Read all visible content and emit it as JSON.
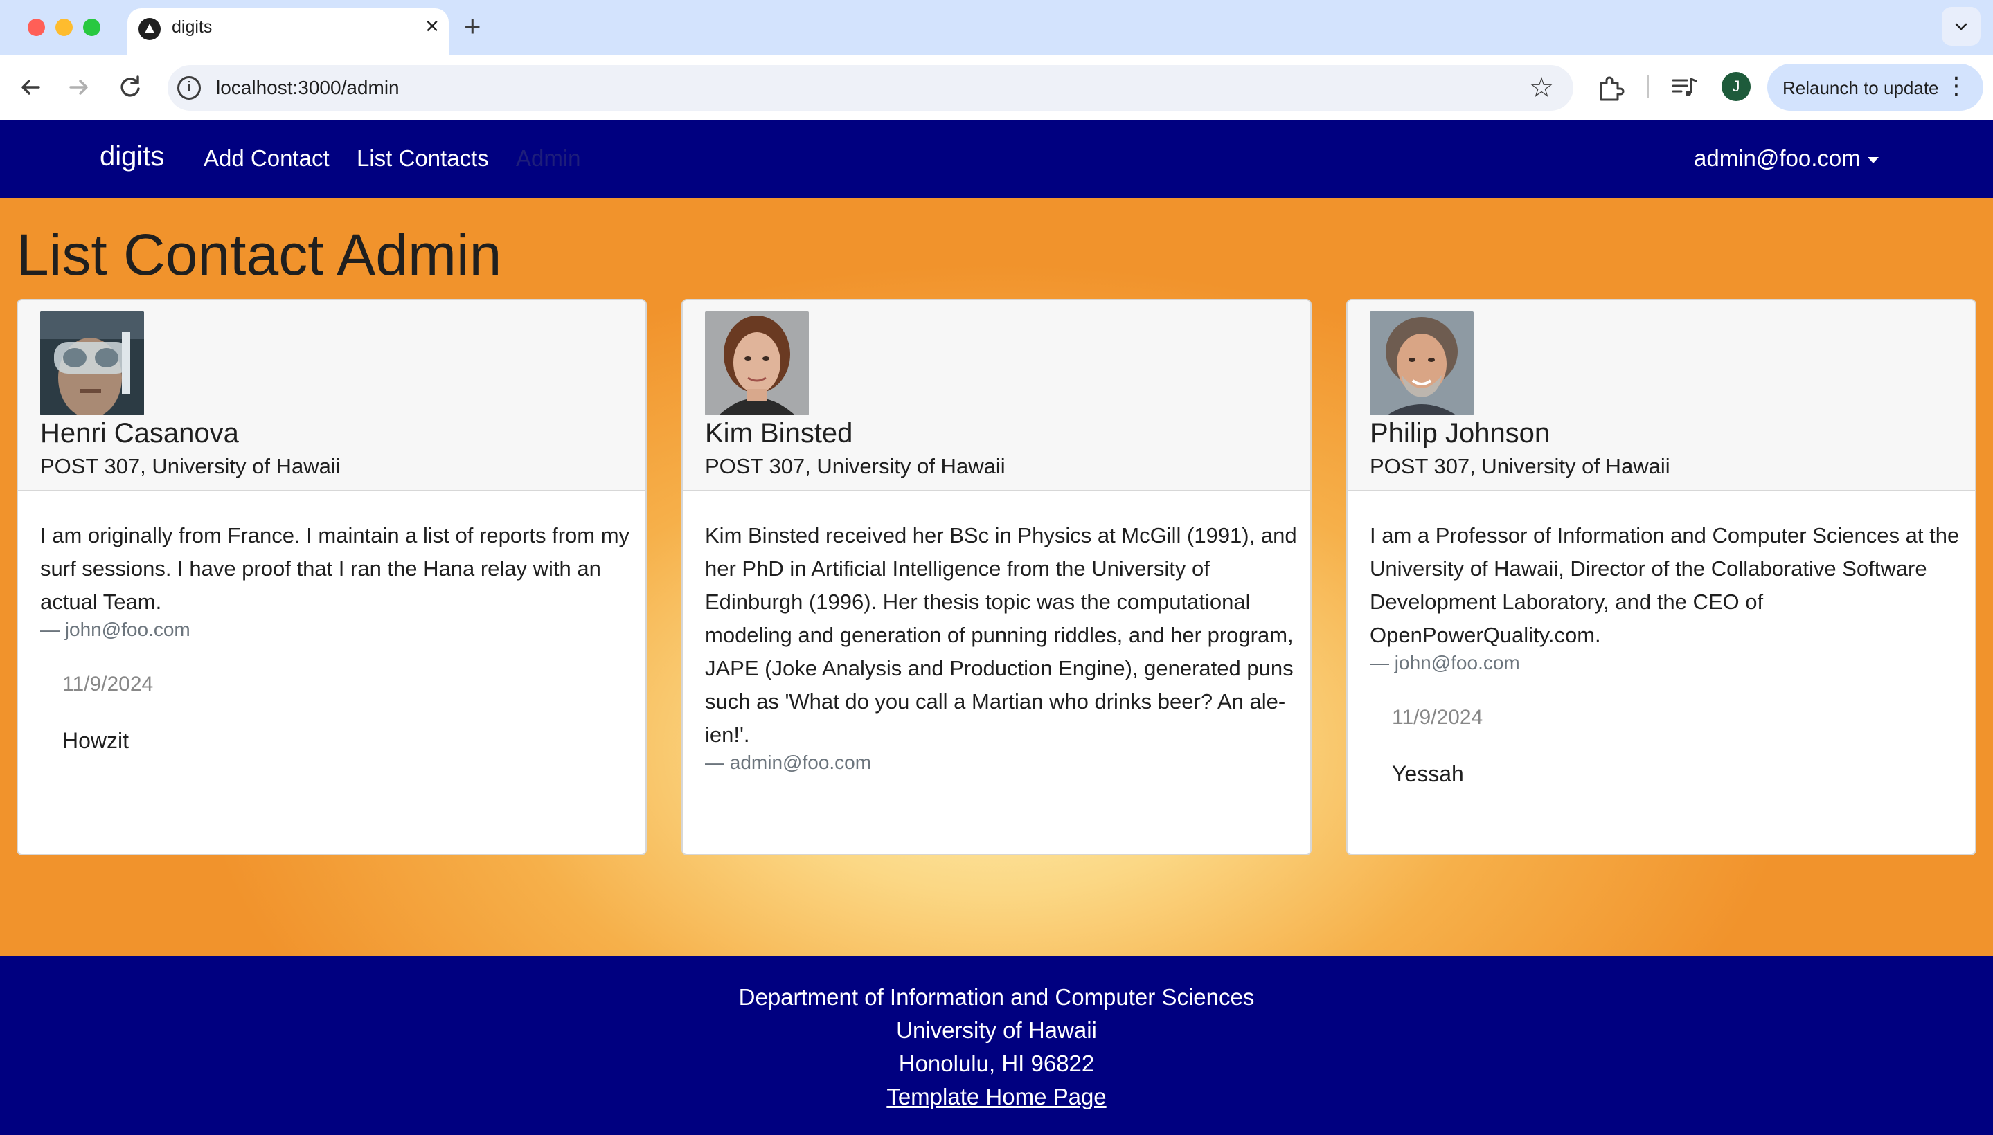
{
  "browser": {
    "tab_title": "digits",
    "url": "localhost:3000/admin",
    "profile_initial": "J",
    "relaunch_label": "Relaunch to update"
  },
  "navbar": {
    "brand": "digits",
    "links": [
      "Add Contact",
      "List Contacts",
      "Admin"
    ],
    "active_link": "Admin",
    "user": "admin@foo.com"
  },
  "page": {
    "title": "List Contact Admin"
  },
  "contacts": [
    {
      "name": "Henri Casanova",
      "address": "POST 307, University of Hawaii",
      "description": "I am originally from France. I maintain a list of reports from my surf sessions. I have proof that I ran the Hana relay with an actual Team.",
      "owner": "— john@foo.com",
      "note_date": "11/9/2024",
      "note_text": "Howzit"
    },
    {
      "name": "Kim Binsted",
      "address": "POST 307, University of Hawaii",
      "description": "Kim Binsted received her BSc in Physics at McGill (1991), and her PhD in Artificial Intelligence from the University of Edinburgh (1996). Her thesis topic was the computational modeling and generation of punning riddles, and her program, JAPE (Joke Analysis and Production Engine), generated puns such as 'What do you call a Martian who drinks beer? An ale-ien!'.",
      "owner": "— admin@foo.com"
    },
    {
      "name": "Philip Johnson",
      "address": "POST 307, University of Hawaii",
      "description": "I am a Professor of Information and Computer Sciences at the University of Hawaii, Director of the Collaborative Software Development Laboratory, and the CEO of OpenPowerQuality.com.",
      "owner": "— john@foo.com",
      "note_date": "11/9/2024",
      "note_text": "Yessah"
    }
  ],
  "footer": {
    "line1": "Department of Information and Computer Sciences",
    "line2": "University of Hawaii",
    "line3": "Honolulu, HI 96822",
    "link": "Template Home Page"
  },
  "colors": {
    "navbar_bg": "#000080",
    "footer_bg": "#000080",
    "background_outer": "#f1932c",
    "background_center": "#fdeeb0"
  }
}
